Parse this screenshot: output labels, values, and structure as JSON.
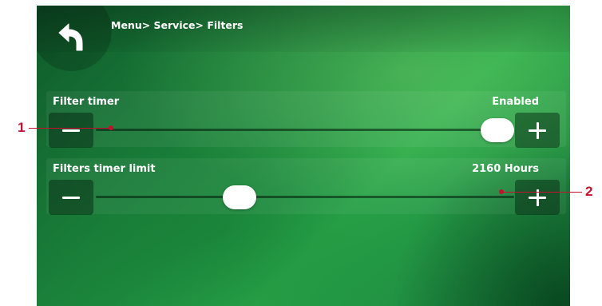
{
  "header": {
    "breadcrumb": "Menu> Service> Filters",
    "back_icon": "back-arrow-icon"
  },
  "settings": [
    {
      "label": "Filter timer",
      "value": "Enabled",
      "slider_level": 1.0,
      "minus_icon": "minus-icon",
      "plus_icon": "plus-icon"
    },
    {
      "label": "Filters timer limit",
      "value": "2160 Hours",
      "slider_level": 0.33,
      "minus_icon": "minus-icon",
      "plus_icon": "plus-icon"
    }
  ],
  "callouts": [
    "1",
    "2"
  ],
  "colors": {
    "callout": "#c8102e",
    "accent_green": "#2aa84a",
    "dark_green": "#0f5a2b"
  }
}
